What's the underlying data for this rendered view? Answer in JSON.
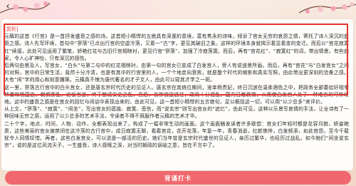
{
  "nav": {
    "back_label": "‹"
  },
  "content": {
    "heading": "[赏析]",
    "p1": "元稹的这首《行宫》是一首抒发盛衰之感的诗。这首短小精悍的五绝具有深邃的意境，富有隽永的诗味，倾诉了宫女无穷的哀怨之情，寄托了诗人深沉的盛衰之感。诗人先写环境，首句中“寥落”已点出行宫的空虚冷落，又着一“古”字，更见其破旧之象。这样的环境本身就揭示着显着变的变迁。而后以“宫花寂寞红”续接，此处可见运用了繁笔，娇艳红花与古旧行宫相映衬，更见行宫“寥落”，加强了冷寂落寞。而后，再有“宫花红”、“寂寞红”的词，带出情景。有些曲家，令人心旷神怡，只有深沉的感伤。",
    "p2": "后两句由景及人，写宫女，“白头”与第二句中的红花相映衬，由第一句的宫女已变成了白发宫人，旁人有说道景所画。而后，再有“宫花”与“白发宫女”之间的对照，宫中的日常生活，竟然十分冷清，也是有其中的行宫里的人，一个个地走向衰败，就是整个时代的缩影和真实写照，由此带出更深刻的沧桑之感。大有“闲”字的用心和刻意雕琢。元稹真不愧为唐代著名的才子文人，由此可以窥其才学之一斑。",
    "p3": "这一里，寥落古行宫中的白头宫女，还是唐玄宗时代历史的见证人。唐玄宗在其统位期间，宠幸杨贵妃，终日沉迷在温柔酒色之中，把政务全部委给奸相李林甫和杨国忠，朝纲紊乱，谄佞当道，终于酿成安史之乱，且后，玄宗被迫逃往，政局十分混乱，国力日趋衰微，从而使白发宫人处于一种难言的可怜境地。这中的盛衰之感是在宫女的回忆与闲谈中表现出来的。由此可见，这一首短小精悍的五言绝句，足以概括这一切，可以用“以少总多”来评价。",
    "p4": "从上文，“寥落”、“寂寞”、“闲坐”，写出宫女的孤独、寂寞、悲伤，而“说玄宗”则写出宫女的“追忆”，由此可见，这种以乐景写哀情的手法，让全诗有了一种回味无穷之感，运用了以少总多的艺术手法，令读者不得不佩服作者元稹的艺术才华。",
    "p5": "二十个字，地点、时间、人物、动作，全都表现出来了，构成了一幅非常生动的画面。这个画面触发读者许多联想：宫女们年轻时都是花容月貌，娇姿艳质，这些美丽的宫女被禁闭在这冷落的古行宫中，成日寂寞无聊，看着宫花，花开花落，年复一年，青春消逝，红颜憔悴，白发频添，如此宫怨，至今千载犹令人同情叹惜。再者，这些白发宫女，可以说是一部活的历史。她们当年曾是玄宗时代盛世的见证人，亲历过繁华，也经历过战乱。如今她们“闲坐说玄宗”，说的是这位风流天子，一生盛衰，诗人感慨之深，对当时朝政的讽喻之意，皆在不言中了。"
  },
  "footer": {
    "recite_button": "背诵打卡"
  },
  "colors": {
    "accent": "#f0686e",
    "highlight_border": "#e8342f",
    "heading": "#e04444"
  }
}
